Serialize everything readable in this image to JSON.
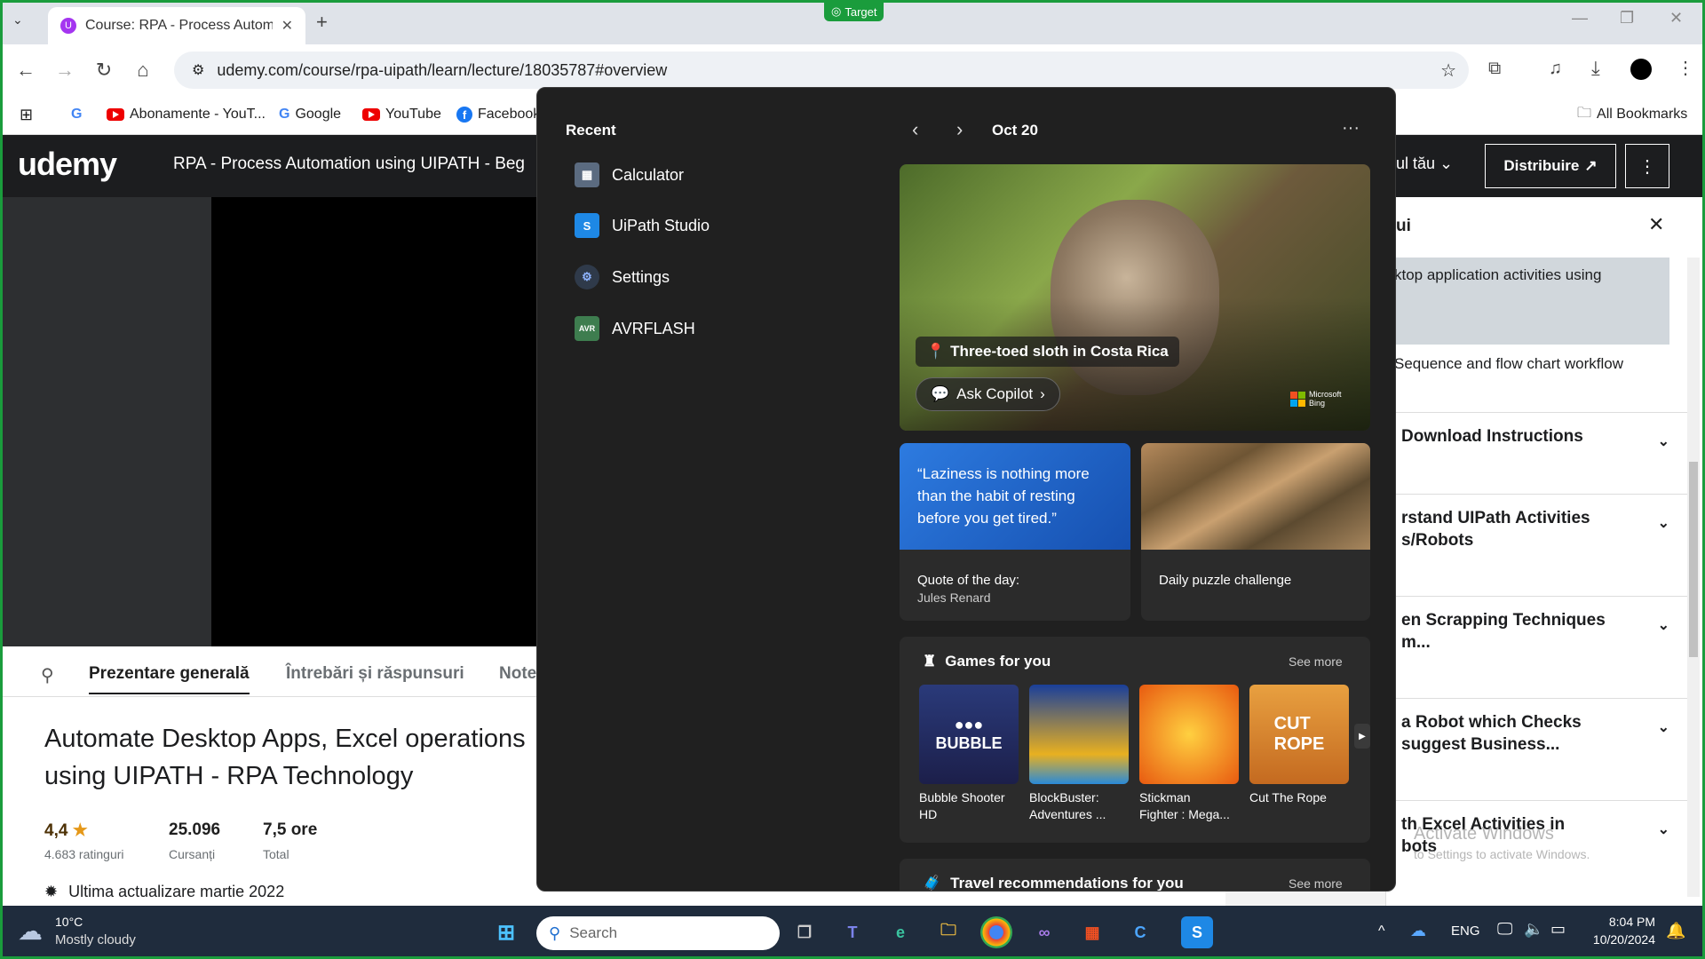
{
  "browser": {
    "target_badge": "Target",
    "tab_title": "Course: RPA - Process Automat",
    "url": "udemy.com/course/rpa-uipath/learn/lecture/18035787#overview",
    "bookmarks": [
      "Abonamente - YouT...",
      "Google",
      "YouTube",
      "Facebook"
    ],
    "all_bookmarks": "All Bookmarks"
  },
  "udemy": {
    "logo": "udemy",
    "course_title": "RPA - Process Automation using UIPATH - Beg",
    "header_right": "ul tău",
    "share_button": "Distribuire",
    "tabs": [
      "Prezentare generală",
      "Întrebări și răspunsuri",
      "Note"
    ],
    "headline_line1": "Automate Desktop Apps, Excel operations",
    "headline_line2": "using UIPATH - RPA Technology",
    "rating": "4,4",
    "rating_sub": "4.683 ratinguri",
    "students": "25.096",
    "students_sub": "Cursanți",
    "hours": "7,5 ore",
    "hours_sub": "Total",
    "last_update": "Ultima actualizare martie 2022"
  },
  "sidebar": {
    "title_fragment": "ui",
    "items": [
      "ktop application activities using",
      "Sequence and flow chart workflow"
    ],
    "sections": [
      "Download Instructions",
      "rstand UIPath Activities\ns/Robots",
      "en Scrapping Techniques\nm...",
      "a Robot which Checks\nsuggest Business...",
      "th Excel Activities in\nbots"
    ],
    "watermark_line1": "Activate Windows",
    "watermark_line2": "to Settings to activate Windows."
  },
  "widgets": {
    "recent_label": "Recent",
    "date": "Oct 20",
    "recent_apps": [
      {
        "name": "Calculator",
        "icon": "calculator-icon"
      },
      {
        "name": "UiPath Studio",
        "icon": "uipath-icon"
      },
      {
        "name": "Settings",
        "icon": "gear-icon"
      },
      {
        "name": "AVRFLASH",
        "icon": "avr-icon"
      }
    ],
    "hero_caption": "Three-toed sloth in Costa Rica",
    "ask_copilot": "Ask Copilot",
    "bing_line1": "Microsoft",
    "bing_line2": "Bing",
    "quote_text": "“Laziness is nothing more than the habit of resting before you get tired.”",
    "quote_label": "Quote of the day:",
    "quote_author": "Jules Renard",
    "puzzle_label": "Daily puzzle challenge",
    "games_title": "Games for you",
    "see_more": "See more",
    "games": [
      {
        "name": "Bubble Shooter HD",
        "line1": "Bubble Shooter",
        "line2": "HD"
      },
      {
        "name": "BlockBuster: Adventures",
        "line1": "BlockBuster:",
        "line2": "Adventures ..."
      },
      {
        "name": "Stickman Fighter",
        "line1": "Stickman",
        "line2": "Fighter : Mega..."
      },
      {
        "name": "Cut The Rope",
        "line1": "Cut The Rope",
        "line2": ""
      }
    ],
    "travel_title": "Travel recommendations for you"
  },
  "taskbar": {
    "temperature": "10°C",
    "weather": "Mostly cloudy",
    "search_placeholder": "Search",
    "language": "ENG",
    "time": "8:04 PM",
    "date": "10/20/2024"
  }
}
